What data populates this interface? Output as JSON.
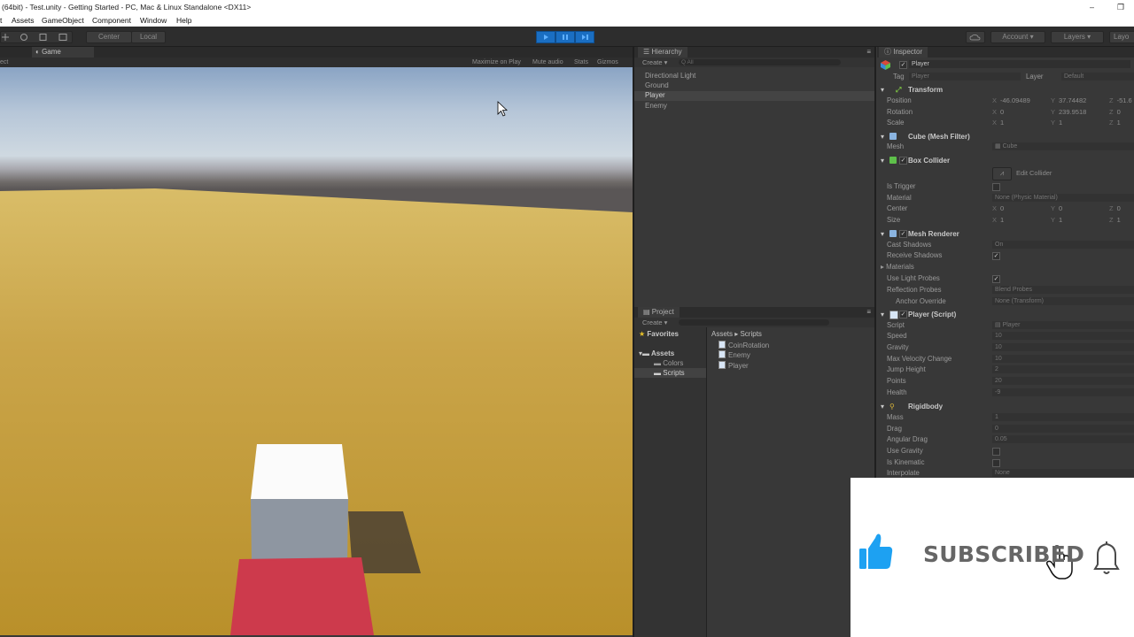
{
  "window": {
    "title": "(64bit) - Test.unity - Getting Started - PC, Mac & Linux Standalone <DX11>",
    "minimize_glyph": "–",
    "restore_glyph": "❐"
  },
  "menu": [
    "t",
    "Assets",
    "GameObject",
    "Component",
    "Window",
    "Help"
  ],
  "toolbar": {
    "pivot_label": "Center",
    "space_label": "Local",
    "account_label": "Account",
    "layers_label": "Layers",
    "layout_label": "Layo"
  },
  "game_view": {
    "tab_label": "Game",
    "left_fragment": "ect",
    "options": [
      "Maximize on Play",
      "Mute audio",
      "Stats",
      "Gizmos"
    ]
  },
  "hierarchy": {
    "tab_label": "Hierarchy",
    "create_label": "Create",
    "search_placeholder": "Q All",
    "items": [
      "Directional Light",
      "Ground",
      "Player",
      "Enemy"
    ],
    "selected_index": 2
  },
  "project": {
    "tab_label": "Project",
    "create_label": "Create",
    "favorites_label": "Favorites",
    "assets_label": "Assets",
    "folders": [
      "Colors",
      "Scripts"
    ],
    "breadcrumb": "Assets ▸ Scripts",
    "files": [
      "CoinRotation",
      "Enemy",
      "Player"
    ]
  },
  "inspector": {
    "tab_label": "Inspector",
    "object_name": "Player",
    "tag_label": "Tag",
    "tag_value": "Player",
    "layer_label": "Layer",
    "layer_value": "Default",
    "transform": {
      "header": "Transform",
      "position_label": "Position",
      "position": {
        "x": "-46.09489",
        "y": "37.74482",
        "z": "-51.6"
      },
      "rotation_label": "Rotation",
      "rotation": {
        "x": "0",
        "y": "239.9518",
        "z": "0"
      },
      "scale_label": "Scale",
      "scale": {
        "x": "1",
        "y": "1",
        "z": "1"
      }
    },
    "mesh_filter": {
      "header": "Cube (Mesh Filter)",
      "mesh_label": "Mesh",
      "mesh_value": "Cube"
    },
    "box_collider": {
      "header": "Box Collider",
      "edit_label": "Edit Collider",
      "is_trigger_label": "Is Trigger",
      "material_label": "Material",
      "material_value": "None (Physic Material)",
      "center_label": "Center",
      "center": {
        "x": "0",
        "y": "0",
        "z": "0"
      },
      "size_label": "Size",
      "size": {
        "x": "1",
        "y": "1",
        "z": "1"
      }
    },
    "mesh_renderer": {
      "header": "Mesh Renderer",
      "cast_shadows_label": "Cast Shadows",
      "cast_shadows_value": "On",
      "receive_shadows_label": "Receive Shadows",
      "materials_label": "Materials",
      "light_probes_label": "Use Light Probes",
      "reflection_probes_label": "Reflection Probes",
      "reflection_probes_value": "Blend Probes",
      "anchor_label": "Anchor Override",
      "anchor_value": "None (Transform)"
    },
    "player_script": {
      "header": "Player (Script)",
      "fields": [
        {
          "label": "Script",
          "value": "Player"
        },
        {
          "label": "Speed",
          "value": "10"
        },
        {
          "label": "Gravity",
          "value": "10"
        },
        {
          "label": "Max Velocity Change",
          "value": "10"
        },
        {
          "label": "Jump Height",
          "value": "2"
        },
        {
          "label": "Points",
          "value": "20"
        },
        {
          "label": "Health",
          "value": "-9"
        }
      ]
    },
    "rigidbody": {
      "header": "Rigidbody",
      "fields": [
        {
          "label": "Mass",
          "value": "1"
        },
        {
          "label": "Drag",
          "value": "0"
        },
        {
          "label": "Angular Drag",
          "value": "0.05"
        },
        {
          "label": "Use Gravity",
          "value": ""
        },
        {
          "label": "Is Kinematic",
          "value": ""
        },
        {
          "label": "Interpolate",
          "value": "None"
        }
      ]
    }
  },
  "overlay": {
    "subscribed_text": "SUBSCRIBED",
    "accent_color": "#1da1f2"
  }
}
